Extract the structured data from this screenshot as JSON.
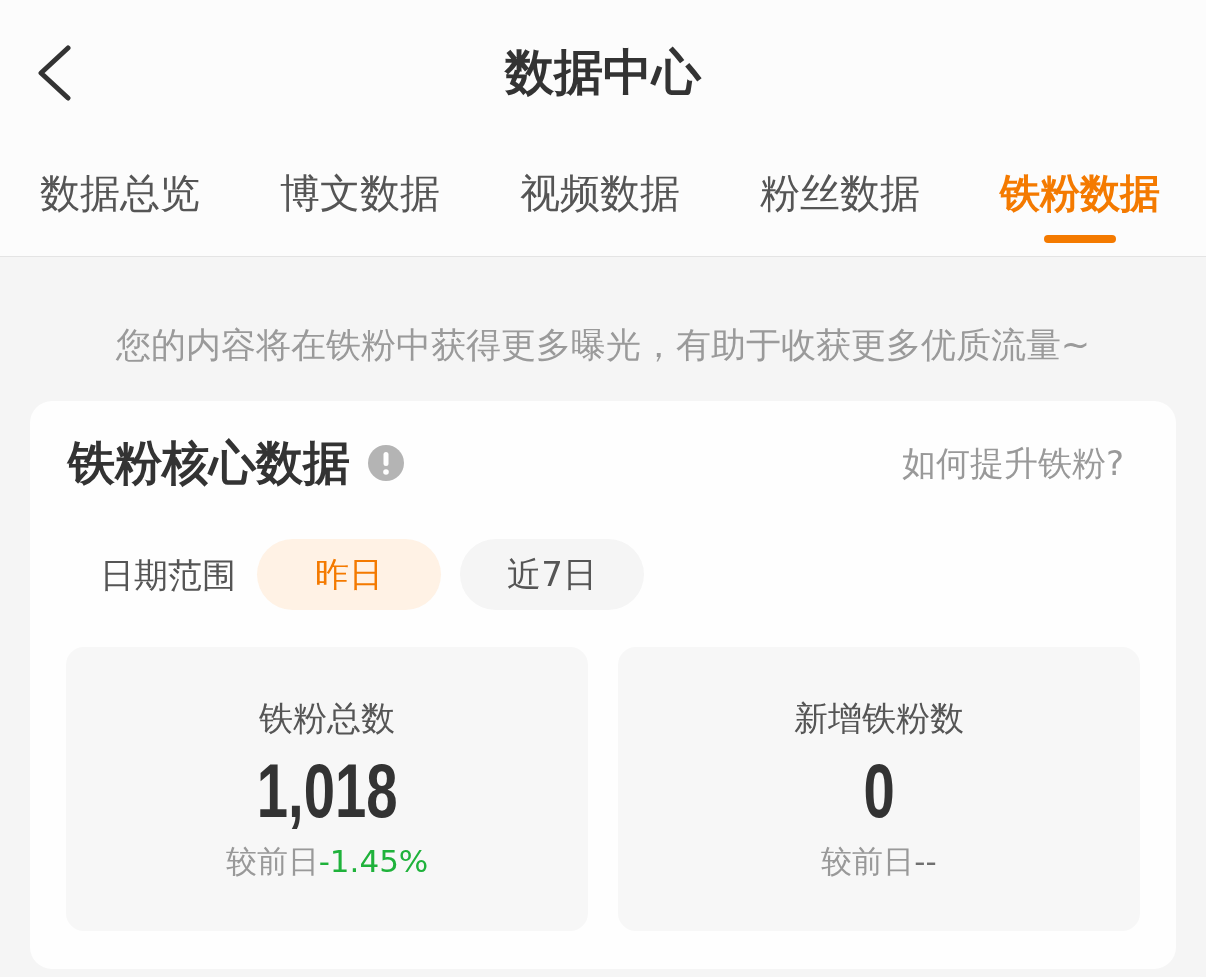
{
  "header": {
    "title": "数据中心"
  },
  "tabs": [
    {
      "label": "数据总览",
      "selected": false
    },
    {
      "label": "博文数据",
      "selected": false
    },
    {
      "label": "视频数据",
      "selected": false
    },
    {
      "label": "粉丝数据",
      "selected": false
    },
    {
      "label": "铁粉数据",
      "selected": true
    }
  ],
  "tip": "您的内容将在铁粉中获得更多曝光，有助于收获更多优质流量~",
  "core_card": {
    "title": "铁粉核心数据",
    "help_link": "如何提升铁粉?",
    "date_range": {
      "label": "日期范围",
      "options": [
        {
          "label": "昨日",
          "selected": true
        },
        {
          "label": "近7日",
          "selected": false
        }
      ]
    },
    "stats": [
      {
        "kind": "decrease",
        "label": "铁粉总数",
        "value": "1,018",
        "change_label": "较前日",
        "change": "-1.45%"
      },
      {
        "kind": "empty",
        "label": "新增铁粉数",
        "value": "0",
        "change_label": "较前日",
        "change": "--"
      }
    ]
  }
}
